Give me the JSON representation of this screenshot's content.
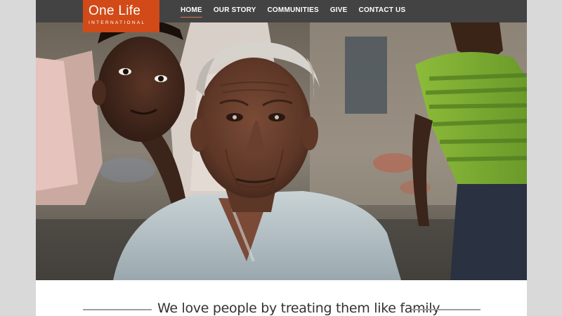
{
  "brand": {
    "name": "One Life",
    "sub": "INTERNATIONAL",
    "color": "#d14a18"
  },
  "nav": {
    "items": [
      {
        "label": "HOME",
        "active": true
      },
      {
        "label": "OUR STORY",
        "active": false
      },
      {
        "label": "COMMUNITIES",
        "active": false
      },
      {
        "label": "GIVE",
        "active": false
      },
      {
        "label": "CONTACT US",
        "active": false
      }
    ]
  },
  "hero": {
    "image": "photo-elderly-man-with-children"
  },
  "tagline": "We love people by treating them like family"
}
